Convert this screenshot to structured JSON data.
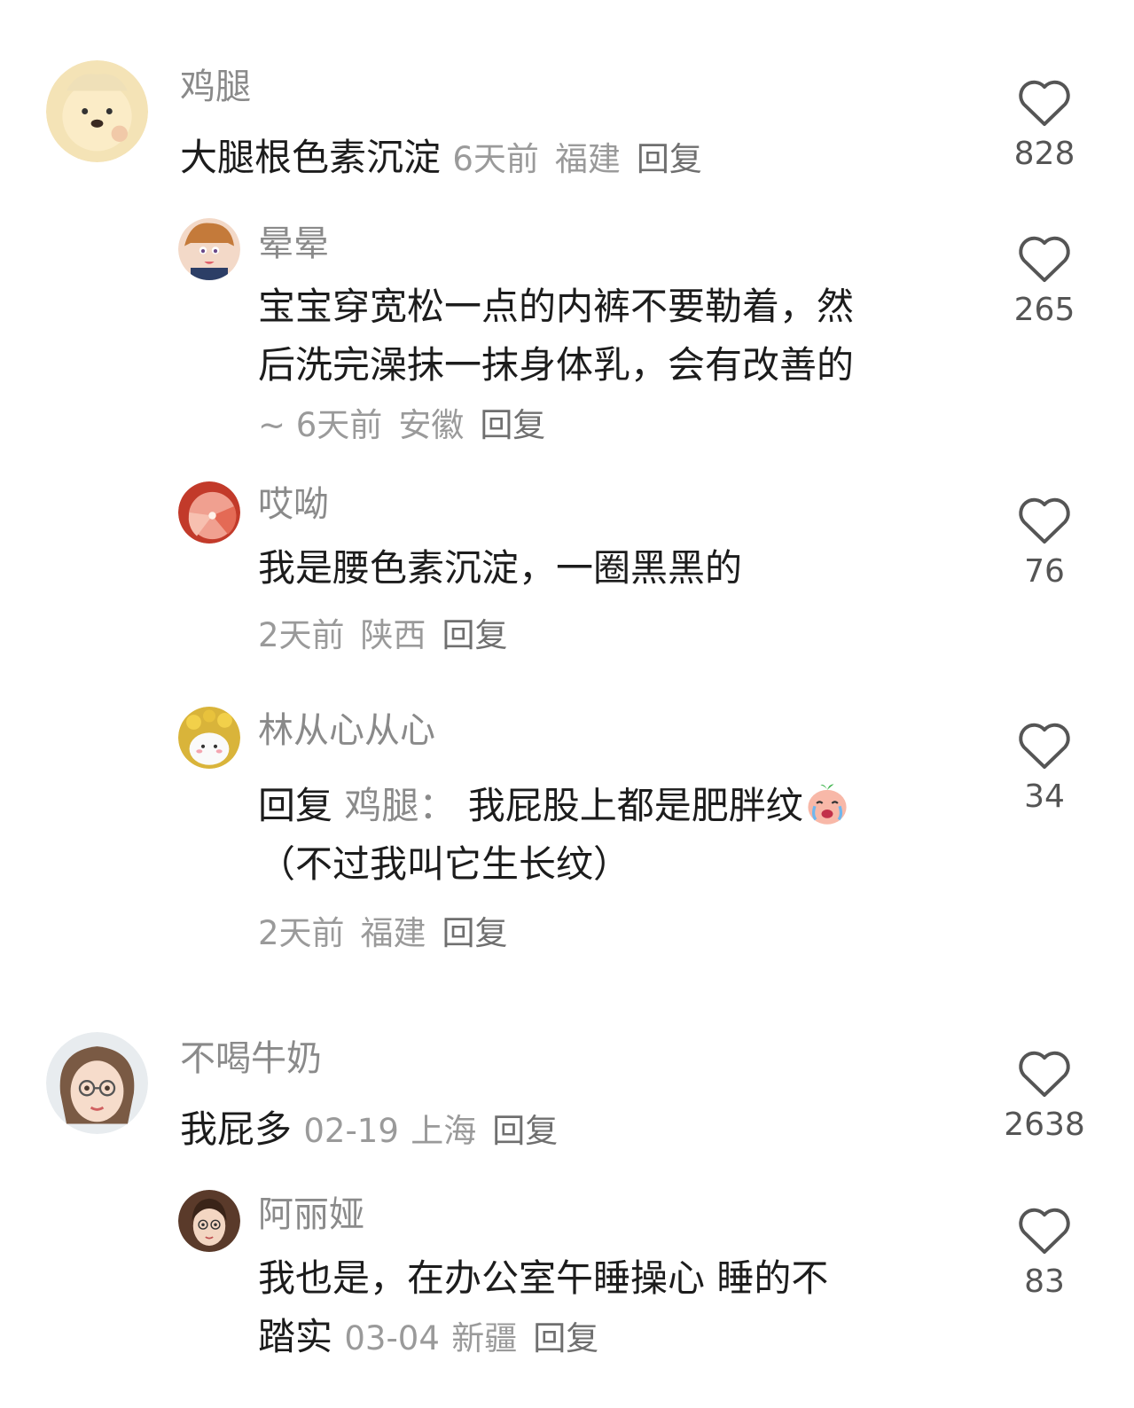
{
  "comments": [
    {
      "user": "鸡腿",
      "text": "大腿根色素沉淀",
      "time": "6天前",
      "location": "福建",
      "reply_label": "回复",
      "likes": "828",
      "replies": [
        {
          "user": "晕晕",
          "text_line1": "宝宝穿宽松一点的内裤不要勒着，然",
          "text_line2": "后洗完澡抹一抹身体乳，会有改善的",
          "time": "~ 6天前",
          "location": "安徽",
          "reply_label": "回复",
          "likes": "265"
        },
        {
          "user": "哎呦",
          "text": "我是腰色素沉淀，一圈黑黑的",
          "time": "2天前",
          "location": "陕西",
          "reply_label": "回复",
          "likes": "76"
        },
        {
          "user": "林从心从心",
          "reply_prefix": "回复",
          "mention": "鸡腿：",
          "text_line1": "我屁股上都是肥胖纹",
          "text_line2": "（不过我叫它生长纹）",
          "emoji": "crying-face-emoji",
          "time": "2天前",
          "location": "福建",
          "reply_label": "回复",
          "likes": "34"
        }
      ]
    },
    {
      "user": "不喝牛奶",
      "text": "我屁多",
      "time": "02-19",
      "location": "上海",
      "reply_label": "回复",
      "likes": "2638",
      "replies": [
        {
          "user": "阿丽娅",
          "text_line1": "我也是，在办公室午睡操心 睡的不",
          "text_line2": "踏实",
          "time": "03-04",
          "location": "新疆",
          "reply_label": "回复",
          "likes": "83"
        }
      ]
    }
  ],
  "icons": {
    "like": "heart-outline-icon"
  }
}
